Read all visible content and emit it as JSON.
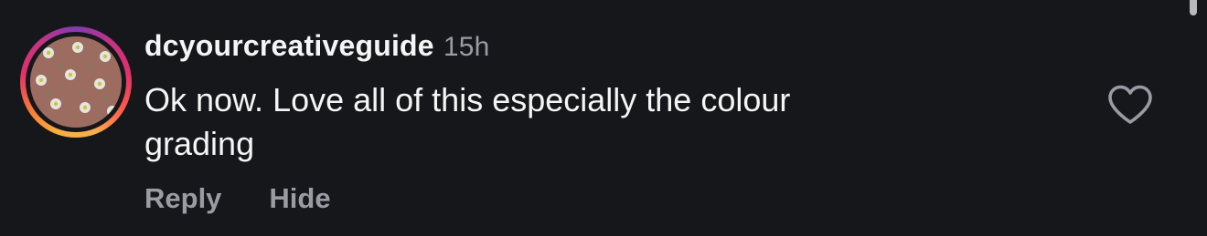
{
  "comment": {
    "username": "dcyourcreativeguide",
    "time": "15h",
    "text_line1": "Ok now. Love all of this especially the colour",
    "text_line2": "grading",
    "actions": {
      "reply": "Reply",
      "hide": "Hide"
    },
    "like_icon": "heart-outline-icon"
  },
  "colors": {
    "background": "#16171b",
    "text": "#f5f5f5",
    "muted": "#9a9ca3"
  }
}
